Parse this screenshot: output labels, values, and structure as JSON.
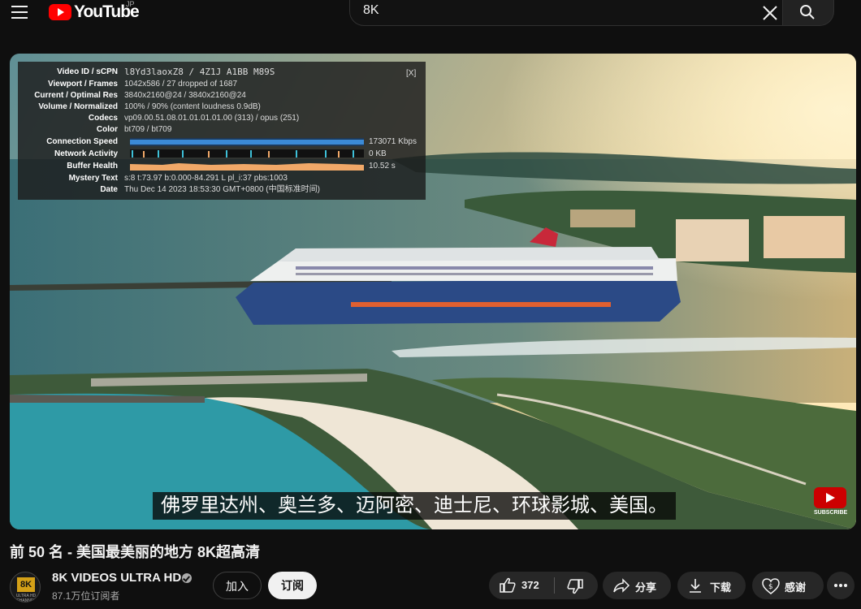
{
  "header": {
    "logo_text": "YouTube",
    "region": "JP",
    "search_value": "8K"
  },
  "player": {
    "stats": {
      "rows": [
        {
          "label": "Video ID / sCPN",
          "value": "l8Yd3laoxZ8 / 4Z1J A1BB M89S"
        },
        {
          "label": "Viewport / Frames",
          "value": "1042x586 / 27 dropped of 1687"
        },
        {
          "label": "Current / Optimal Res",
          "value": "3840x2160@24 / 3840x2160@24"
        },
        {
          "label": "Volume / Normalized",
          "value": "100% / 90% (content loudness 0.9dB)"
        },
        {
          "label": "Codecs",
          "value": "vp09.00.51.08.01.01.01.01.00 (313) / opus (251)"
        },
        {
          "label": "Color",
          "value": "bt709 / bt709"
        },
        {
          "label": "Connection Speed",
          "value": "173071 Kbps"
        },
        {
          "label": "Network Activity",
          "value": "0 KB"
        },
        {
          "label": "Buffer Health",
          "value": "10.52 s"
        },
        {
          "label": "Mystery Text",
          "value": "s:8 t:73.97 b:0.000-84.291 L pl_i:37 pbs:1003"
        },
        {
          "label": "Date",
          "value": "Thu Dec 14 2023 18:53:30 GMT+0800 (中国标准时间)"
        }
      ],
      "close_label": "[X]"
    },
    "subtitle": "佛罗里达州、奥兰多、迈阿密、迪士尼、环球影城、美国。",
    "watermark_text": "SUBSCRIBE"
  },
  "video": {
    "title": "前 50 名 - 美国最美丽的地方 8K超高清",
    "channel_name": "8K VIDEOS ULTRA HD",
    "subscribers": "87.1万位订阅者",
    "avatar_text": "8K",
    "avatar_subtext": "ULTRA HD CHANNEL"
  },
  "actions": {
    "join": "加入",
    "subscribe": "订阅",
    "like_count": "372",
    "share": "分享",
    "download": "下载",
    "thanks": "感谢"
  },
  "colors": {
    "accent": "#ff0000",
    "connection_bar": "#3b8ad6",
    "buffer_bar": "#f0a868"
  }
}
